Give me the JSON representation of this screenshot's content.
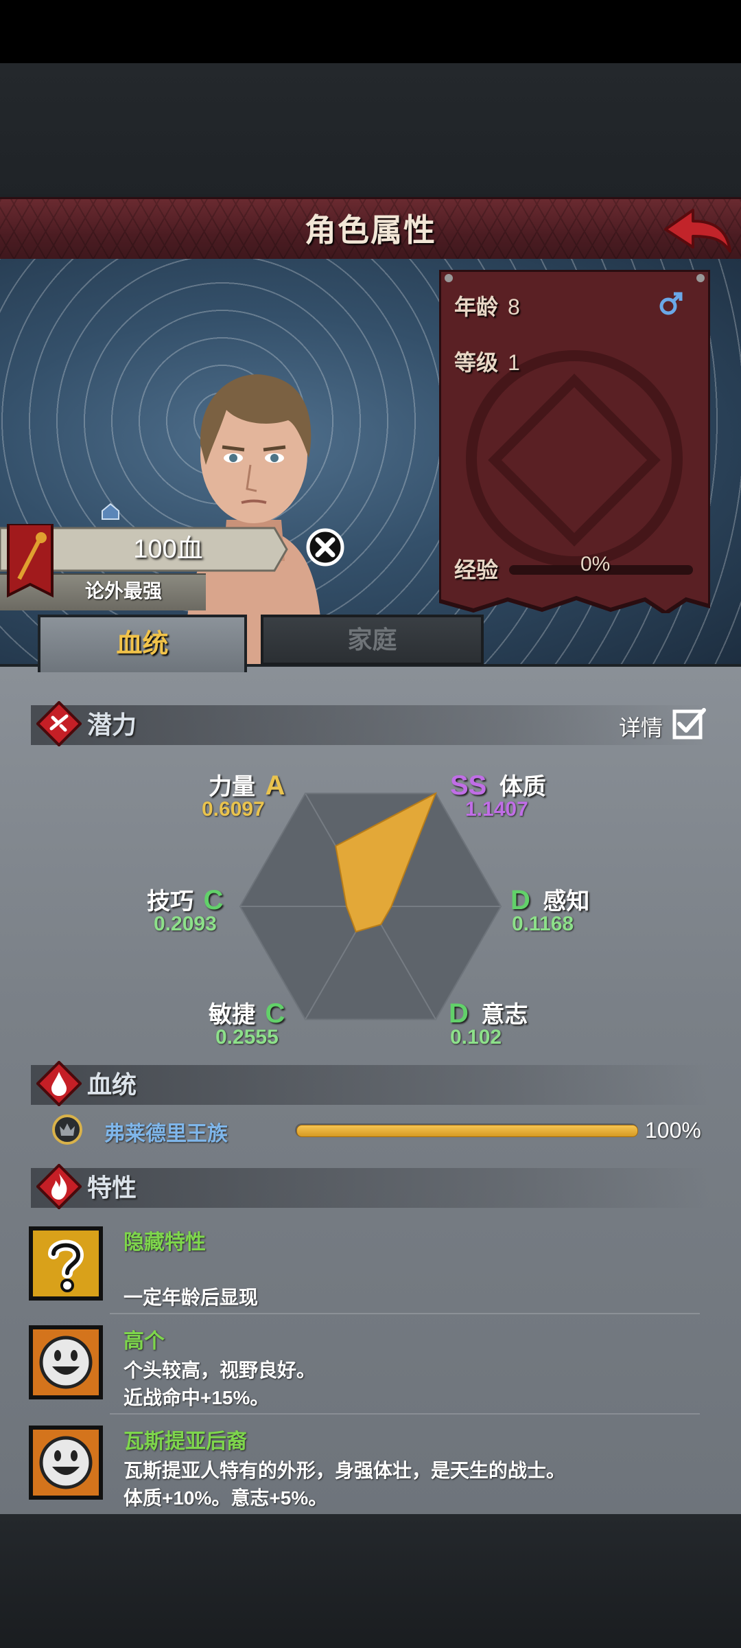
{
  "header": {
    "title": "角色属性"
  },
  "info": {
    "age_label": "年龄",
    "age_value": "8",
    "level_label": "等级",
    "level_value": "1",
    "exp_label": "经验",
    "exp_value": "0%",
    "gender_icon": "male-icon"
  },
  "character": {
    "name_label": "100血",
    "title_label": "论外最强"
  },
  "tabs": [
    {
      "label": "血统",
      "active": true
    },
    {
      "label": "家庭",
      "active": false
    }
  ],
  "sections": {
    "potential": "潜力",
    "bloodline": "血统",
    "traits": "特性"
  },
  "details": {
    "label": "详情",
    "checked": true
  },
  "stats": [
    {
      "name": "力量",
      "grade": "A",
      "value": "0.6097"
    },
    {
      "name": "体质",
      "grade": "SS",
      "value": "1.1407"
    },
    {
      "name": "感知",
      "grade": "D",
      "value": "0.1168"
    },
    {
      "name": "意志",
      "grade": "D",
      "value": "0.102"
    },
    {
      "name": "敏捷",
      "grade": "C",
      "value": "0.2555"
    },
    {
      "name": "技巧",
      "grade": "C",
      "value": "0.2093"
    }
  ],
  "chart_data": {
    "type": "radar",
    "axes": [
      "力量",
      "体质",
      "感知",
      "意志",
      "敏捷",
      "技巧"
    ],
    "values": [
      0.6097,
      1.1407,
      0.1168,
      0.102,
      0.2555,
      0.2093
    ],
    "range": [
      0,
      1.1407
    ],
    "fill_color": "#e3a838"
  },
  "lineage": {
    "name": "弗莱德里王族",
    "percent_label": "100%",
    "fraction": 1.0
  },
  "traits": [
    {
      "name": "隐藏特性",
      "desc1": "",
      "desc2": "一定年龄后显现",
      "icon": "question-mark-icon"
    },
    {
      "name": "高个",
      "desc1": "个头较高，视野良好。",
      "desc2": "近战命中+15%。",
      "icon": "smiley-face-icon"
    },
    {
      "name": "瓦斯提亚后裔",
      "desc1": "瓦斯提亚人特有的外形，身强体壮，是天生的战士。",
      "desc2": "体质+10%。意志+5%。",
      "icon": "smiley-face-icon"
    }
  ],
  "colors": {
    "grade_A": "#e9c34e",
    "grade_SS": "#c06ee6",
    "grade_C": "#62d16a",
    "grade_D": "#62d16a",
    "val_yellow": "#e9c34e",
    "val_purple": "#c06ee6",
    "val_green": "#8de08a"
  }
}
